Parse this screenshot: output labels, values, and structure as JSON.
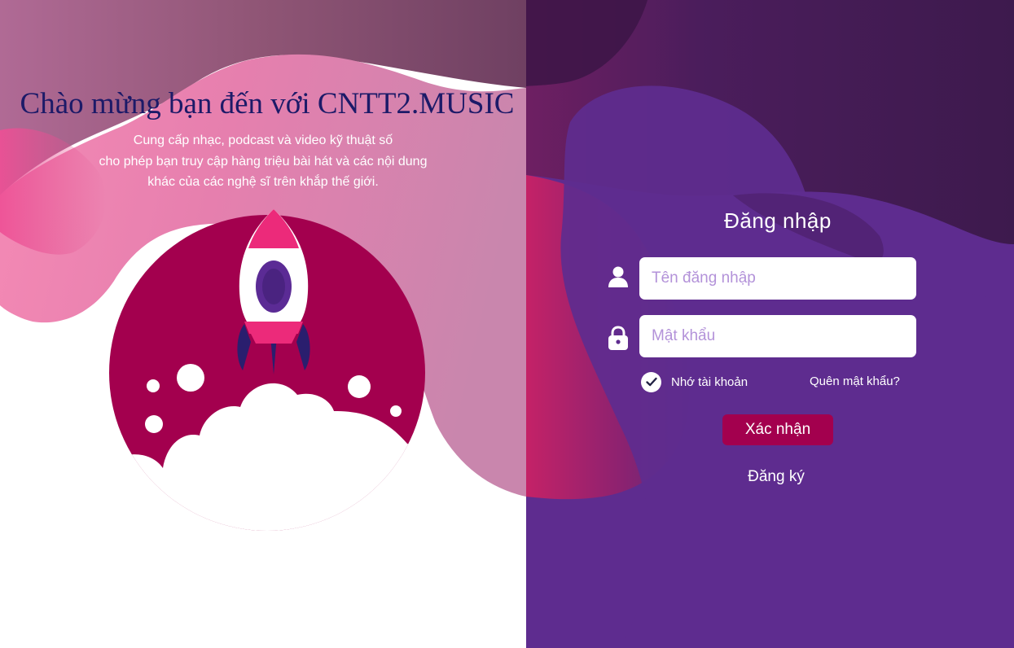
{
  "welcome": {
    "title": "Chào mừng bạn đến với CNTT2.MUSIC",
    "description": [
      "Cung cấp nhạc, podcast và video kỹ thuật số",
      "cho phép bạn truy cập hàng triệu bài hát và các nội dung",
      "khác của các nghệ sĩ trên khắp thế giới."
    ]
  },
  "login": {
    "title": "Đăng nhập",
    "username_placeholder": "Tên đăng nhập",
    "username_value": "",
    "password_placeholder": "Mật khẩu",
    "password_value": "",
    "remember_label": "Nhớ tài khoản",
    "remember_checked": true,
    "forgot_label": "Quên mật khẩu?",
    "submit_label": "Xác nhận",
    "register_label": "Đăng ký"
  },
  "icons": {
    "username": "user-icon",
    "password": "lock-icon",
    "remember": "checkmark-icon",
    "illustration": "rocket-icon"
  },
  "colors": {
    "panel_purple": "#5e2c8f",
    "accent_magenta": "#a3004e",
    "title_navy": "#1c1a68",
    "placeholder": "#b392d9"
  }
}
